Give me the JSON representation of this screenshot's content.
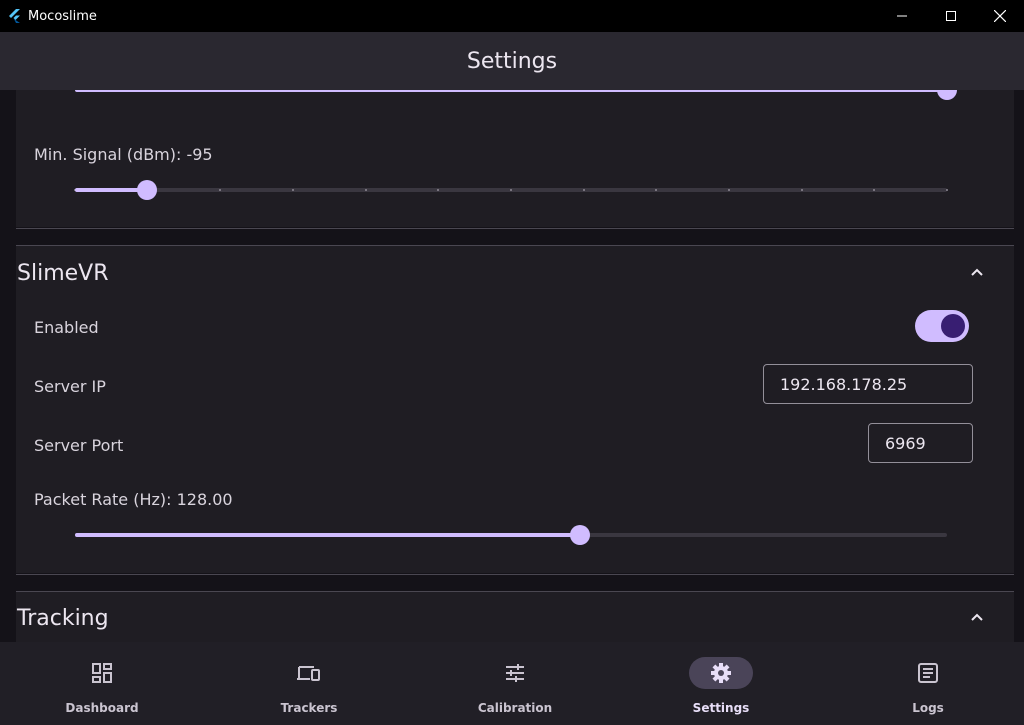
{
  "window": {
    "title": "Mocoslime"
  },
  "appbar": {
    "title": "Settings"
  },
  "top_section": {
    "slider_value_fraction": 1.0,
    "min_signal": {
      "label": "Min. Signal (dBm): -95",
      "value_fraction": 0.083
    }
  },
  "slimevr": {
    "title": "SlimeVR",
    "enabled": {
      "label": "Enabled",
      "on": true
    },
    "server_ip": {
      "label": "Server IP",
      "value": "192.168.178.25"
    },
    "server_port": {
      "label": "Server Port",
      "value": "6969"
    },
    "packet_rate": {
      "label": "Packet Rate (Hz): 128.00",
      "value_fraction": 0.579
    }
  },
  "tracking": {
    "title": "Tracking"
  },
  "nav": {
    "items": [
      {
        "label": "Dashboard",
        "icon": "dashboard-icon"
      },
      {
        "label": "Trackers",
        "icon": "devices-icon"
      },
      {
        "label": "Calibration",
        "icon": "tune-icon"
      },
      {
        "label": "Settings",
        "icon": "gear-icon",
        "active": true
      },
      {
        "label": "Logs",
        "icon": "article-icon"
      }
    ]
  },
  "colors": {
    "accent": "#d0bcff",
    "surface": "#1f1d23",
    "background": "#141218",
    "appbar": "#2a2830",
    "nav_active": "#4a4458"
  }
}
